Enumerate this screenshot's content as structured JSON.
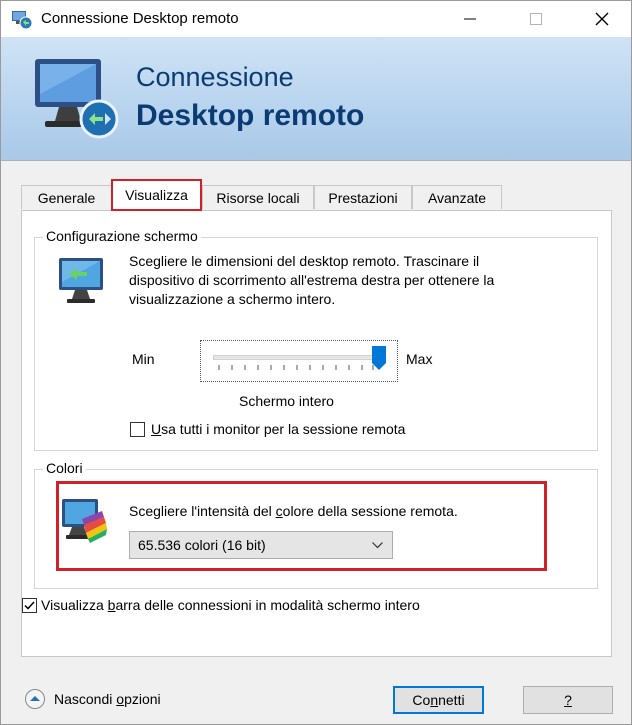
{
  "window": {
    "title": "Connessione Desktop remoto"
  },
  "banner": {
    "line1": "Connessione",
    "line2": "Desktop remoto"
  },
  "tabs": [
    {
      "label": "Generale"
    },
    {
      "label": "Visualizza",
      "active": true
    },
    {
      "label": "Risorse locali"
    },
    {
      "label": "Prestazioni"
    },
    {
      "label": "Avanzate"
    }
  ],
  "display": {
    "group_title": "Configurazione schermo",
    "description_lines": [
      "Scegliere le dimensioni del desktop remoto. Trascinare il",
      "dispositivo di scorrimento all'estrema destra per ottenere la",
      "visualizzazione a schermo intero."
    ],
    "slider_min": "Min",
    "slider_max": "Max",
    "slider_value": "Schermo intero",
    "slider_level": 1.0,
    "all_monitors": {
      "pre": "",
      "key": "U",
      "post": "sa tutti i monitor per la sessione remota",
      "checked": false
    }
  },
  "colors": {
    "group_title": "Colori",
    "description": {
      "pre": "Scegliere l'intensità del ",
      "key": "c",
      "post": "olore della sessione remota."
    },
    "selected": "65.536 colori (16 bit)"
  },
  "connection_bar": {
    "pre": "Visualizza ",
    "key": "b",
    "post": "arra delle connessioni in modalità schermo intero",
    "checked": true
  },
  "footer": {
    "hide_pre": "Nascondi ",
    "hide_key": "o",
    "hide_post": "pzioni",
    "connect_pre": "Co",
    "connect_key": "n",
    "connect_post": "netti",
    "help": "?"
  },
  "accent_colors": {
    "highlight": "#d12027",
    "focus": "#0078d7",
    "title_blue": "#0a3b73"
  }
}
